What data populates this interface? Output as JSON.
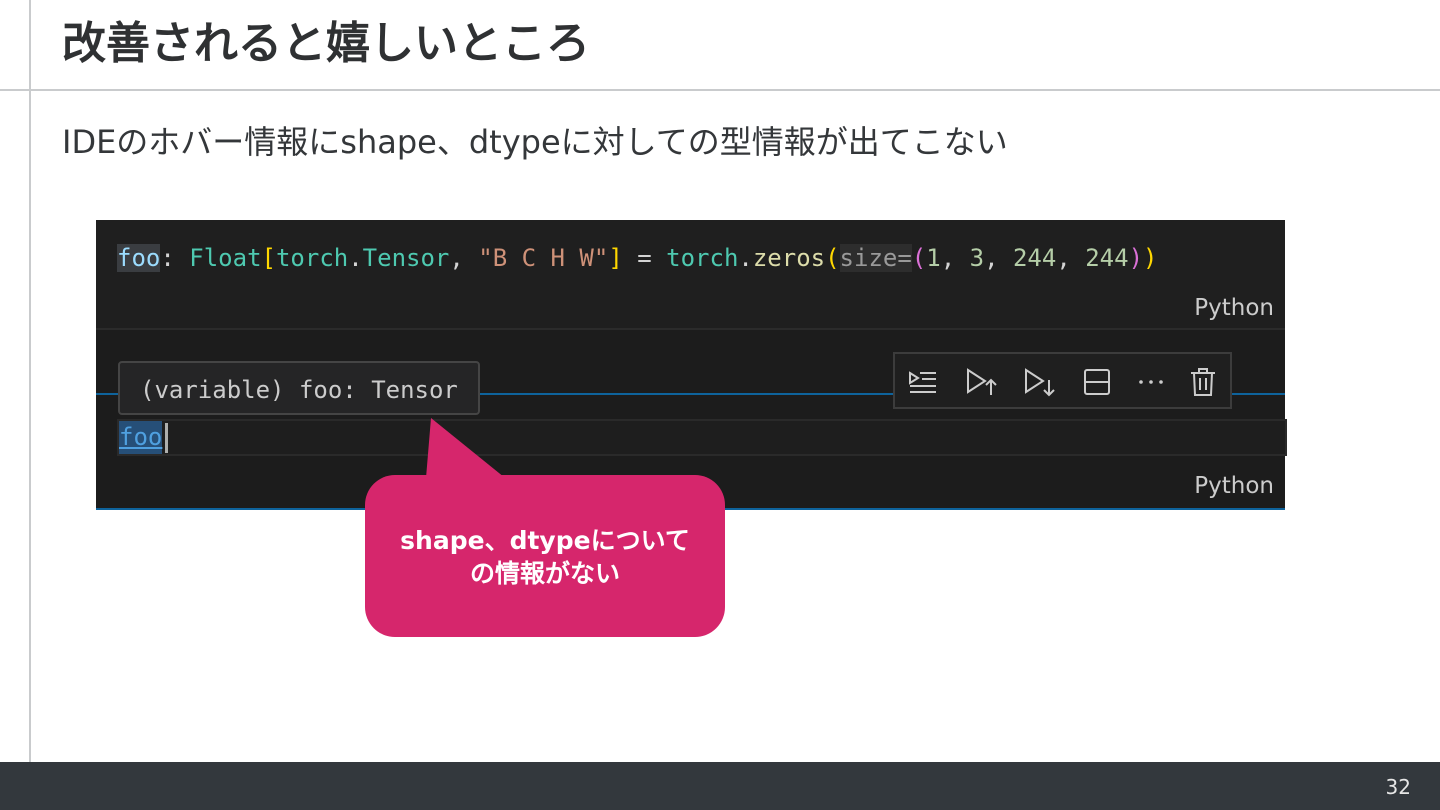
{
  "slide": {
    "title": "改善されると嬉しいところ",
    "subtitle": "IDEのホバー情報にshape、dtypeに対しての型情報が出てこない",
    "page_number": "32"
  },
  "code_cell": {
    "tokens": {
      "var": "foo",
      "colon": ": ",
      "type": "Float",
      "br_open": "[",
      "module": "torch",
      "dot1": ".",
      "class": "Tensor",
      "comma1": ", ",
      "string": "\"B C H W\"",
      "br_close": "]",
      "assign": " = ",
      "module2": "torch",
      "dot2": ".",
      "func": "zeros",
      "paren_open": "(",
      "param": "size=",
      "tuple_open": "(",
      "n1": "1",
      "c2": ", ",
      "n2": "3",
      "c3": ", ",
      "n3": "244",
      "c4": ", ",
      "n4": "244",
      "tuple_close": ")",
      "paren_close": ")"
    },
    "language": "Python"
  },
  "second_cell": {
    "code": "foo",
    "language": "Python",
    "hover_text": "(variable) foo: Tensor"
  },
  "toolbar": {
    "icons": [
      "run-by-line-icon",
      "execute-above-icon",
      "execute-below-icon",
      "split-cell-icon",
      "more-icon",
      "delete-icon"
    ]
  },
  "callout": {
    "line1": "shape、dtypeについて",
    "line2": "の情報がない",
    "color": "#d6266c"
  }
}
